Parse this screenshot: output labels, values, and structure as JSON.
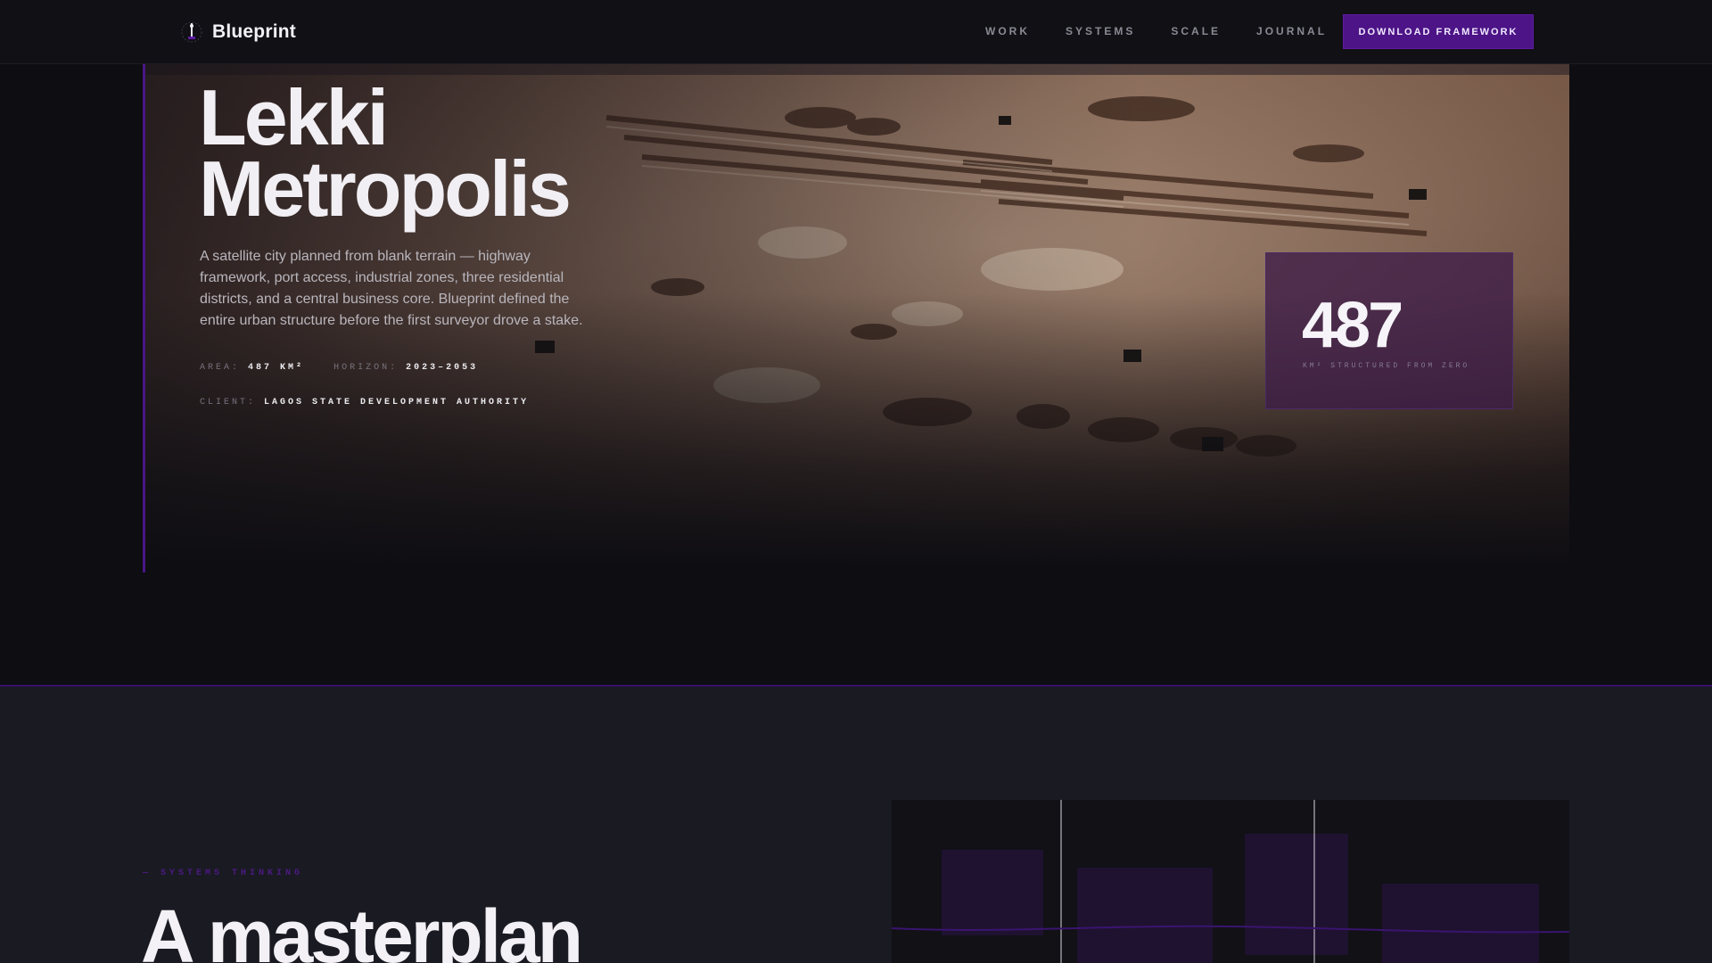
{
  "nav": {
    "brand": "Blueprint",
    "links": [
      "WORK",
      "SYSTEMS",
      "SCALE",
      "JOURNAL"
    ],
    "cta": "DOWNLOAD FRAMEWORK"
  },
  "hero": {
    "title_line1": "Lekki",
    "title_line2": "Metropolis",
    "description": "A satellite city planned from blank terrain — highway framework, port access, industrial zones, three residential districts, and a central business core. Blueprint defined the entire urban structure before the first surveyor drove a stake.",
    "meta": {
      "area_label": "AREA:",
      "area_value": "487 KM²",
      "horizon_label": "HORIZON:",
      "horizon_value": "2023–2053",
      "client_label": "CLIENT:",
      "client_value": "LAGOS STATE DEVELOPMENT AUTHORITY"
    },
    "stat": {
      "value": "487",
      "label": "KM² STRUCTURED FROM ZERO"
    }
  },
  "section2": {
    "eyebrow": "— SYSTEMS THINKING",
    "heading": "A masterplan"
  },
  "colors": {
    "accent": "#4c1486",
    "background": "#0d0d12",
    "section_bg": "#1a1a23"
  }
}
